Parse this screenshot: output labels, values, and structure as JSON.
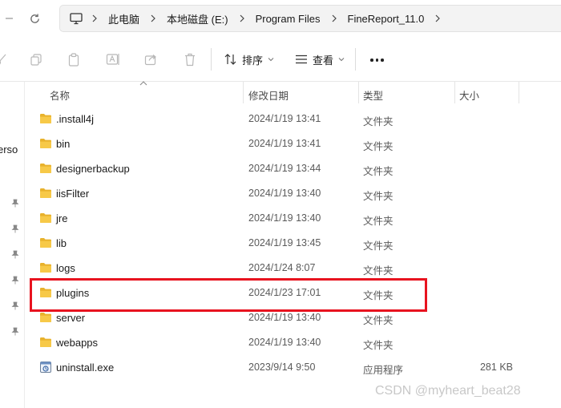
{
  "breadcrumbs": [
    "此电脑",
    "本地磁盘 (E:)",
    "Program Files",
    "FineReport_11.0"
  ],
  "toolbar": {
    "sort_label": "排序",
    "view_label": "查看"
  },
  "nav_pane": {
    "partial_text": "erso"
  },
  "columns": {
    "name": "名称",
    "date": "修改日期",
    "type": "类型",
    "size": "大小"
  },
  "files": [
    {
      "name": ".install4j",
      "date": "2024/1/19 13:41",
      "type": "文件夹",
      "size": "",
      "kind": "folder"
    },
    {
      "name": "bin",
      "date": "2024/1/19 13:41",
      "type": "文件夹",
      "size": "",
      "kind": "folder"
    },
    {
      "name": "designerbackup",
      "date": "2024/1/19 13:44",
      "type": "文件夹",
      "size": "",
      "kind": "folder"
    },
    {
      "name": "iisFilter",
      "date": "2024/1/19 13:40",
      "type": "文件夹",
      "size": "",
      "kind": "folder"
    },
    {
      "name": "jre",
      "date": "2024/1/19 13:40",
      "type": "文件夹",
      "size": "",
      "kind": "folder"
    },
    {
      "name": "lib",
      "date": "2024/1/19 13:45",
      "type": "文件夹",
      "size": "",
      "kind": "folder"
    },
    {
      "name": "logs",
      "date": "2024/1/24 8:07",
      "type": "文件夹",
      "size": "",
      "kind": "folder"
    },
    {
      "name": "plugins",
      "date": "2024/1/23 17:01",
      "type": "文件夹",
      "size": "",
      "kind": "folder"
    },
    {
      "name": "server",
      "date": "2024/1/19 13:40",
      "type": "文件夹",
      "size": "",
      "kind": "folder"
    },
    {
      "name": "webapps",
      "date": "2024/1/19 13:40",
      "type": "文件夹",
      "size": "",
      "kind": "folder"
    },
    {
      "name": "uninstall.exe",
      "date": "2023/9/14 9:50",
      "type": "应用程序",
      "size": "281 KB",
      "kind": "exe"
    }
  ],
  "highlighted_file": "plugins",
  "watermark": "CSDN @myheart_beat28",
  "colors": {
    "folder_yellow": "#f7c948",
    "highlight_red": "#e8131f",
    "address_bg": "#f3f3f3"
  }
}
